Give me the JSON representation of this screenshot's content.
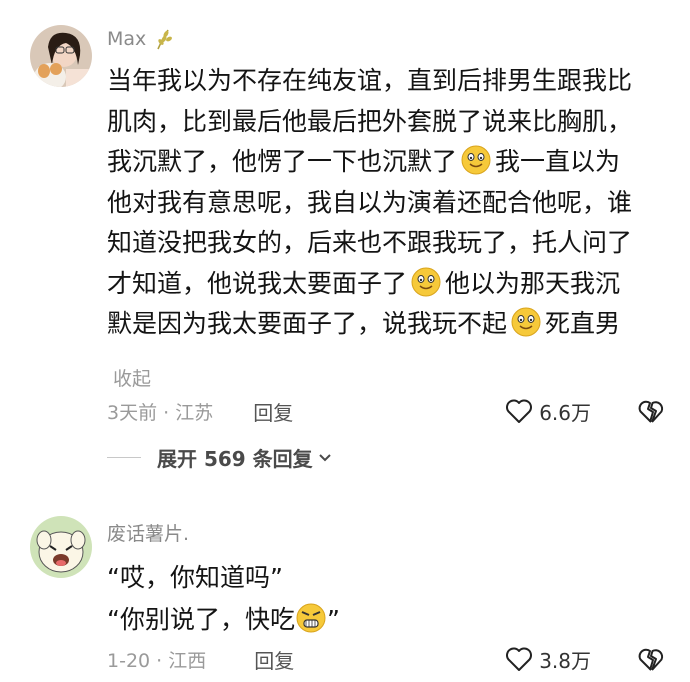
{
  "comments": [
    {
      "username": "Max",
      "user_badge_icon": "wheat-badge-icon",
      "lines": [
        "当年我以为不存在纯友谊，直到后排男生跟我比",
        "肌肉，比到最后他最后把外套脱了说来比胸肌，",
        "我沉默了，他愣了一下也沉默了",
        "我一直以为",
        "他对我有意思呢，我自以为演着还配合他呢，谁",
        "知道没把我女的，后来也不跟我玩了，托人问了",
        "才知道，他说我太要面子了",
        "他以为那天我沉",
        "默是因为我太要面子了，说我玩不起",
        "死直男"
      ],
      "collapse_label": "收起",
      "time_location": "3天前 · 江苏",
      "reply_label": "回复",
      "like_count": "6.6万"
    },
    {
      "username": "废话薯片.",
      "lines": [
        "“哎，你知道吗”",
        "“你别说了，快吃",
        "”"
      ],
      "time_location": "1-20 · 江西",
      "reply_label": "回复",
      "like_count": "3.8万"
    }
  ],
  "expand_replies_label": "展开 569 条回复",
  "icons": {
    "like": "heart-outline-icon",
    "dislike": "broken-heart-icon",
    "emoji_1": "smiling-face-emoji-icon",
    "emoji_2": "angry-face-emoji-icon"
  },
  "colors": {
    "text": "#141414",
    "meta": "#9a9a9a",
    "emoji_yellow": "#f6c93a"
  }
}
